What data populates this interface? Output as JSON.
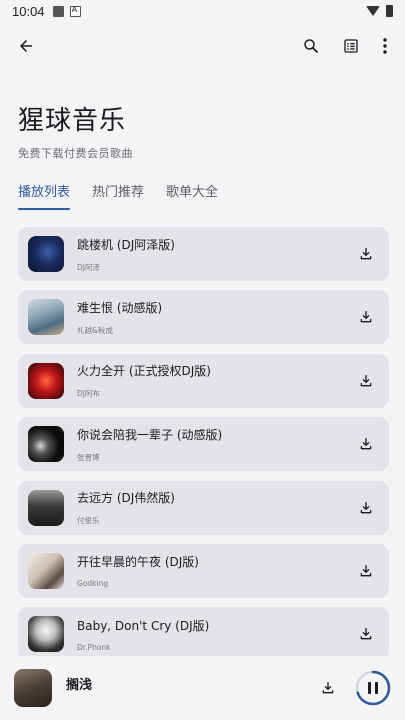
{
  "status": {
    "time": "10:04"
  },
  "header": {
    "title": "猩球音乐",
    "subtitle": "免费下载付费会员歌曲"
  },
  "tabs": [
    {
      "label": "播放列表",
      "active": true
    },
    {
      "label": "热门推荐",
      "active": false
    },
    {
      "label": "歌单大全",
      "active": false
    }
  ],
  "songs": [
    {
      "title": "跳楼机 (DJ阿泽版)",
      "artist": "DJ阿泽"
    },
    {
      "title": "难生恨 (动感版)",
      "artist": "礼越&秋成"
    },
    {
      "title": "火力全开 (正式授权DJ版)",
      "artist": "DJ阿布"
    },
    {
      "title": "你说会陪我一辈子 (动感版)",
      "artist": "张晋博"
    },
    {
      "title": "去远方 (DJ伟然版)",
      "artist": "付俊乐"
    },
    {
      "title": "开往早晨的午夜 (DJ版)",
      "artist": "Godking"
    },
    {
      "title": "Baby, Don't Cry (DJ版)",
      "artist": "Dr.Phonk"
    }
  ],
  "player": {
    "now_playing": "搁浅",
    "progress": 0.7
  },
  "colors": {
    "accent": "#2f5a9c",
    "card": "#e4e3e8",
    "background": "#f4f3f6"
  }
}
